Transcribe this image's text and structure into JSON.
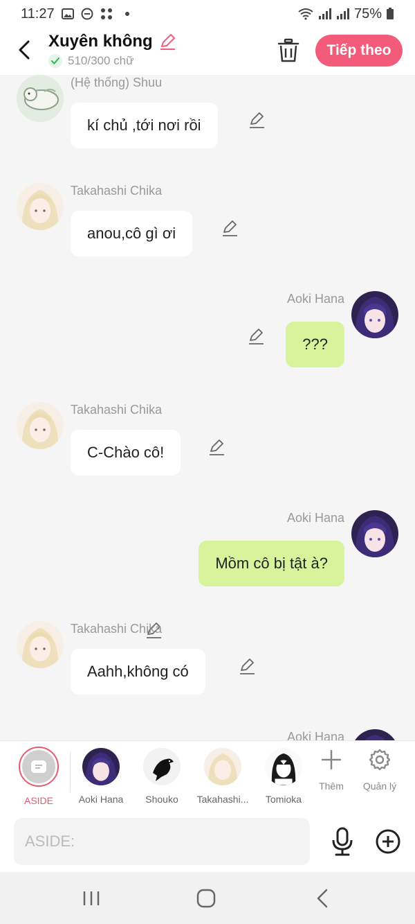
{
  "status_bar": {
    "time": "11:27",
    "battery": "75%"
  },
  "header": {
    "title": "Xuyên không",
    "word_count": "510/300 chữ",
    "next_label": "Tiếp theo"
  },
  "messages": [
    {
      "side": "left",
      "sender": "(Hệ thống) Shuu",
      "text": "kí chủ ,tới nơi rồi",
      "avatar": "shuu-avatar"
    },
    {
      "side": "left",
      "sender": "Takahashi Chika",
      "text": "anou,cô gì ơi",
      "avatar": "chika-avatar"
    },
    {
      "side": "right",
      "sender": "Aoki Hana",
      "text": "???",
      "avatar": "hana-avatar"
    },
    {
      "side": "left",
      "sender": "Takahashi Chika",
      "text": "C-Chào cô!",
      "avatar": "chika-avatar"
    },
    {
      "side": "right",
      "sender": "Aoki Hana",
      "text": "Mồm cô bị tật à?",
      "avatar": "hana-avatar"
    },
    {
      "side": "left",
      "sender": "Takahashi Chika",
      "text": "Aahh,không có",
      "avatar": "chika-avatar"
    },
    {
      "side": "right",
      "sender": "Aoki Hana",
      "text": "",
      "avatar": "hana-avatar"
    }
  ],
  "characters": {
    "aside_label": "ASIDE",
    "items": [
      {
        "label": "Aoki Hana"
      },
      {
        "label": "Shouko"
      },
      {
        "label": "Takahashi..."
      },
      {
        "label": "Tomioka"
      }
    ],
    "add_label": "Thêm",
    "manage_label": "Quản lý"
  },
  "input": {
    "placeholder": "ASIDE:",
    "value": ""
  },
  "colors": {
    "accent": "#f25c7a",
    "right_bubble": "#d7f49c",
    "aside_ring": "#e75b6f"
  }
}
